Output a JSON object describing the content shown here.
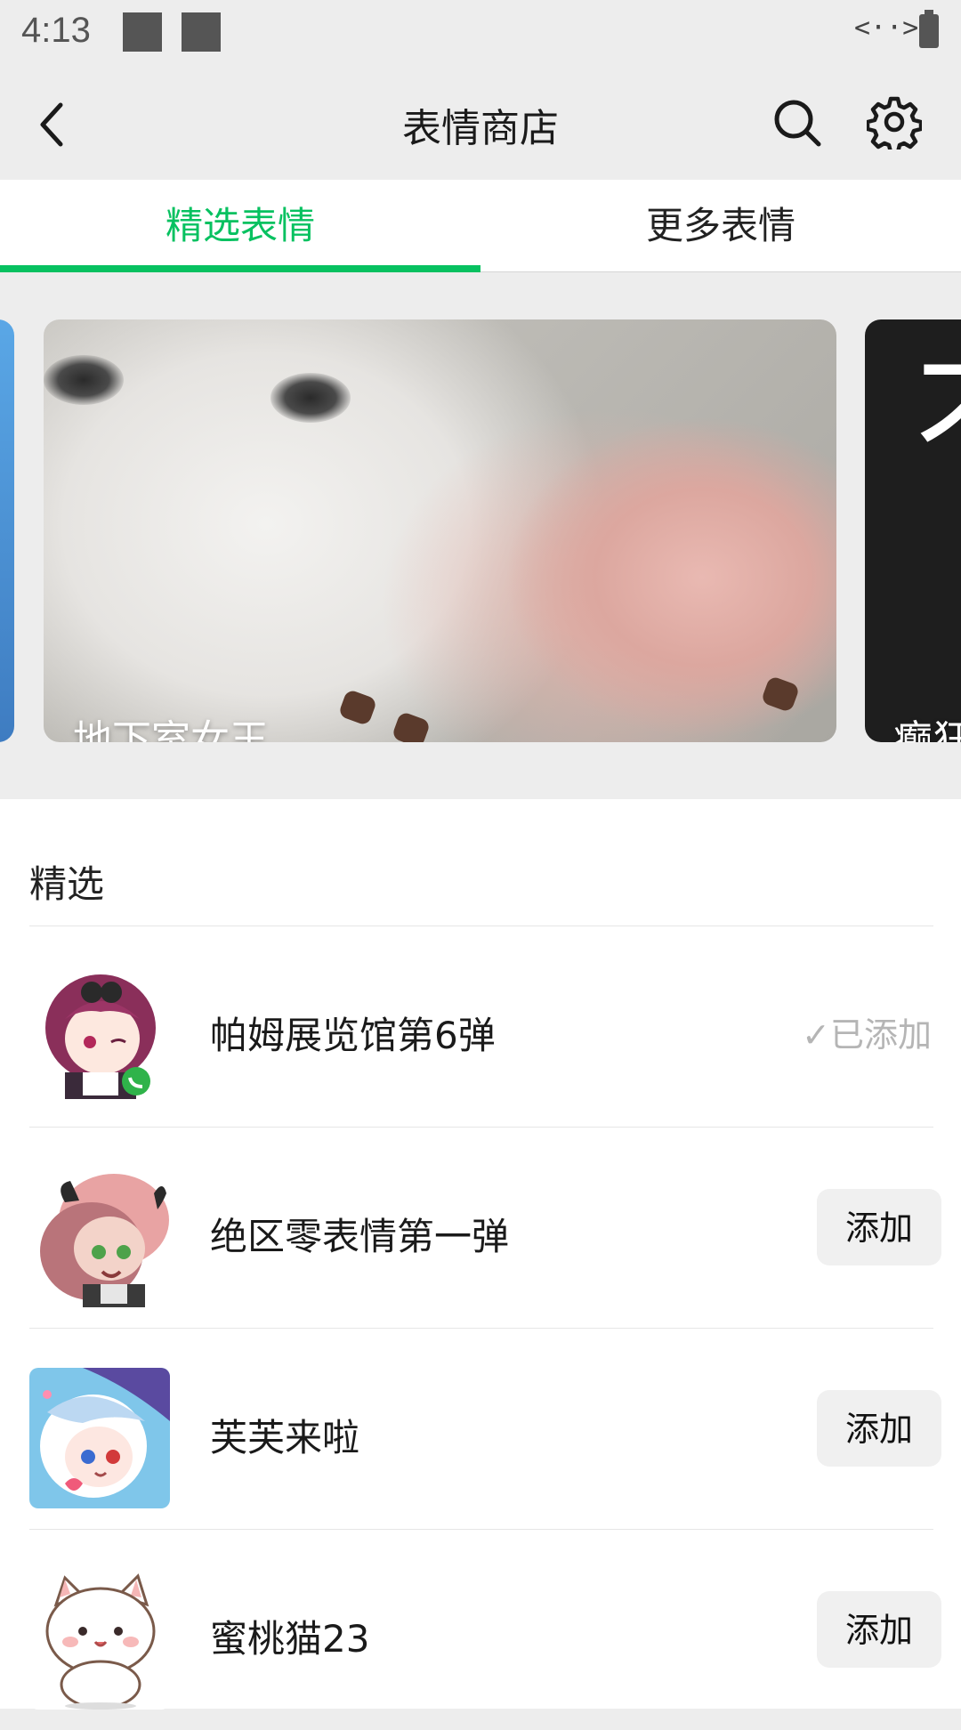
{
  "status_bar": {
    "time": "4:13",
    "network_code": "<··>"
  },
  "header": {
    "title": "表情商店",
    "icons": [
      "back-arrow-icon",
      "search-icon",
      "gear-icon"
    ]
  },
  "tabs": [
    {
      "label": "精选表情",
      "active": true
    },
    {
      "label": "更多表情",
      "active": false
    }
  ],
  "banners": [
    {
      "caption": "地下室女王"
    },
    {
      "caption": "癫狂",
      "big_char": "不"
    }
  ],
  "section": {
    "title": "精选"
  },
  "items": [
    {
      "title": "帕姆展览馆第6弹",
      "status": "已添加",
      "added": true
    },
    {
      "title": "绝区零表情第一弹",
      "button": "添加",
      "added": false
    },
    {
      "title": "芙芙来啦",
      "button": "添加",
      "added": false
    },
    {
      "title": "蜜桃猫23",
      "button": "添加",
      "added": false
    }
  ],
  "colors": {
    "accent": "#07c160",
    "background": "#ededed"
  }
}
